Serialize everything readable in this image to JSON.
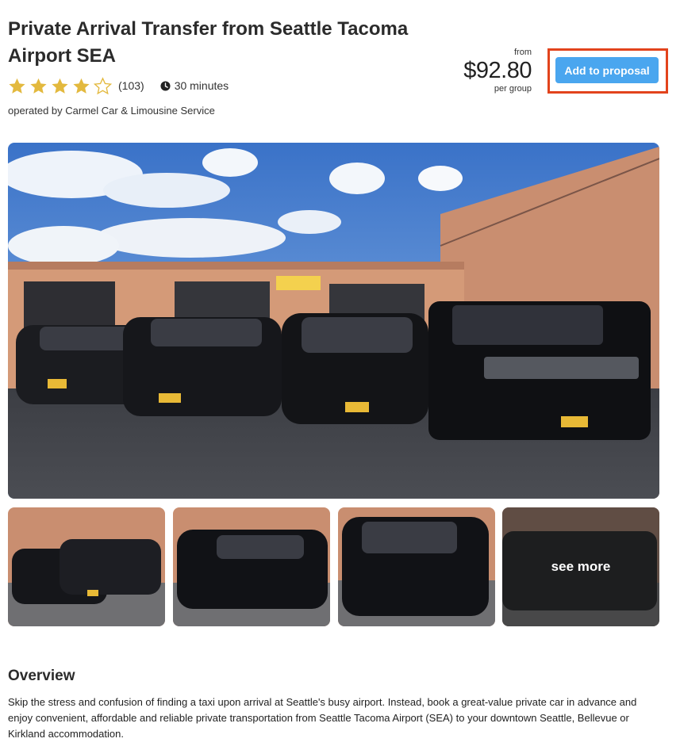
{
  "product": {
    "title": "Private Arrival Transfer from Seattle Tacoma Airport SEA",
    "rating": 4,
    "rating_max": 5,
    "reviews": "(103)",
    "duration": "30 minutes",
    "operator": "operated by Carmel Car & Limousine Service",
    "icons": {
      "star": "star-icon",
      "clock": "clock-icon"
    },
    "star_color": "#e3b93e"
  },
  "price": {
    "from": "from",
    "amount": "$92.80",
    "unit": "per group"
  },
  "actions": {
    "add_to_proposal": "Add to proposal",
    "button_color": "#4aa6ef",
    "highlight_color": "#e2431c"
  },
  "gallery": {
    "see_more": "see more"
  },
  "overview": {
    "heading": "Overview",
    "text": "Skip the stress and confusion of finding a taxi upon arrival at Seattle's busy airport. Instead, book a great-value private car in advance and enjoy convenient, affordable and reliable private transportation from Seattle Tacoma Airport (SEA) to your downtown Seattle, Bellevue or Kirkland accommodation."
  }
}
